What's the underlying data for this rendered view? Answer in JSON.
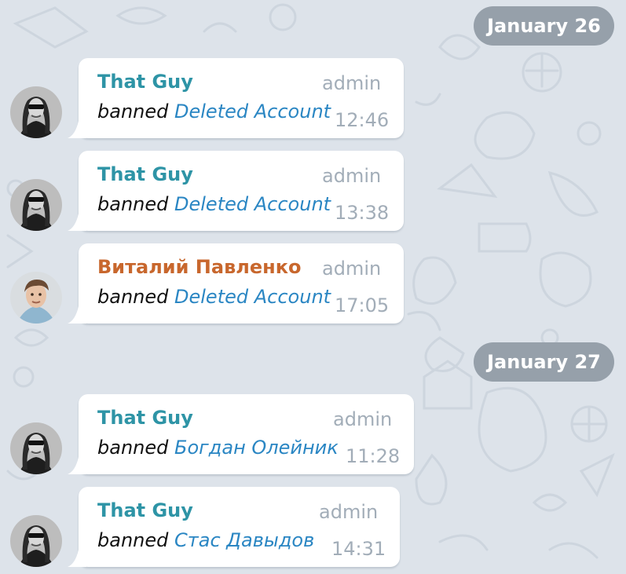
{
  "date_separators": [
    {
      "label": "January 26"
    },
    {
      "label": "January 27"
    }
  ],
  "messages": [
    {
      "sender": "That Guy",
      "role": "admin",
      "action": "banned",
      "target": "Deleted Account",
      "time": "12:46",
      "avatar": "avatar-that-guy"
    },
    {
      "sender": "That Guy",
      "role": "admin",
      "action": "banned",
      "target": "Deleted Account",
      "time": "13:38",
      "avatar": "avatar-that-guy"
    },
    {
      "sender": "Виталий Павленко",
      "role": "admin",
      "action": "banned",
      "target": "Deleted Account",
      "time": "17:05",
      "avatar": "avatar-vitaliy"
    },
    {
      "sender": "That Guy",
      "role": "admin",
      "action": "banned",
      "target": "Богдан Олейник",
      "time": "11:28",
      "avatar": "avatar-that-guy"
    },
    {
      "sender": "That Guy",
      "role": "admin",
      "action": "banned",
      "target": "Стас Давыдов",
      "time": "14:31",
      "avatar": "avatar-that-guy"
    }
  ],
  "colors": {
    "background": "#dde3ea",
    "date_chip": "#96a0aa",
    "sender_teal": "#2e94a6",
    "sender_orange": "#c8672d",
    "link_blue": "#2a86c3",
    "meta_gray": "#a2adb8"
  }
}
